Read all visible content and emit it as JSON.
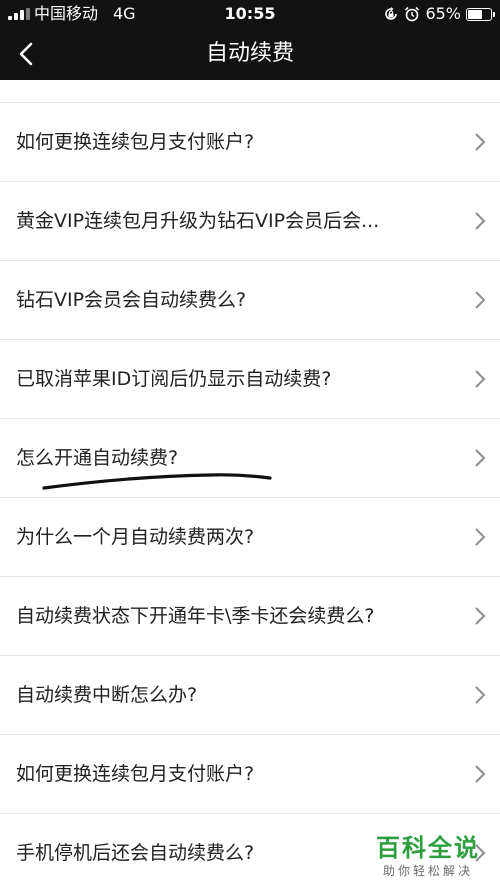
{
  "status_bar": {
    "carrier": "中国移动",
    "network": "4G",
    "time": "10:55",
    "battery_percent_text": "65%",
    "battery_level": 0.65,
    "icons": [
      "signal-icon",
      "orientation-lock-icon",
      "alarm-icon",
      "battery-icon"
    ]
  },
  "nav": {
    "title": "自动续费",
    "back_icon": "chevron-left-icon"
  },
  "faq": {
    "items": [
      {
        "label": "如何更换连续包月支付账户?"
      },
      {
        "label": "黄金VIP连续包月升级为钻石VIP会员后会..."
      },
      {
        "label": "钻石VIP会员会自动续费么?"
      },
      {
        "label": "已取消苹果ID订阅后仍显示自动续费?"
      },
      {
        "label": "怎么开通自动续费?"
      },
      {
        "label": "为什么一个月自动续费两次?"
      },
      {
        "label": "自动续费状态下开通年卡\\季卡还会续费么?"
      },
      {
        "label": "自动续费中断怎么办?"
      },
      {
        "label": "如何更换连续包月支付账户?"
      },
      {
        "label": "手机停机后还会自动续费么?"
      }
    ]
  },
  "watermark": {
    "title": "百科全说",
    "subtitle": "助你轻松解决"
  },
  "colors": {
    "header_bg": "#121212",
    "text": "#222222",
    "divider": "#e5e5e5",
    "chevron": "#8e8e8e",
    "watermark_green": "#2f9e3f"
  }
}
